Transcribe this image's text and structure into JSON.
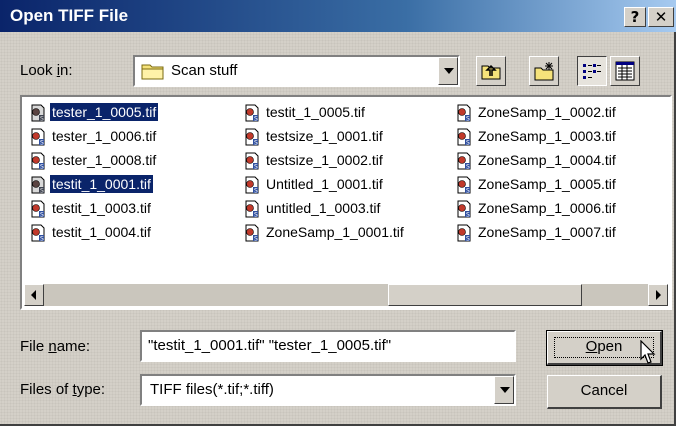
{
  "window": {
    "title": "Open TIFF File",
    "help_label": "?",
    "close_label": "✕"
  },
  "look_in": {
    "label_pre": "Look ",
    "label_accel": "i",
    "label_post": "n:",
    "value": "Scan stuff"
  },
  "files": {
    "columns": [
      [
        {
          "name": "tester_1_0005.tif",
          "selected": true
        },
        {
          "name": "tester_1_0006.tif",
          "selected": false
        },
        {
          "name": "tester_1_0008.tif",
          "selected": false
        },
        {
          "name": "testit_1_0001.tif",
          "selected": true
        },
        {
          "name": "testit_1_0003.tif",
          "selected": false
        },
        {
          "name": "testit_1_0004.tif",
          "selected": false
        }
      ],
      [
        {
          "name": "testit_1_0005.tif",
          "selected": false
        },
        {
          "name": "testsize_1_0001.tif",
          "selected": false
        },
        {
          "name": "testsize_1_0002.tif",
          "selected": false
        },
        {
          "name": "Untitled_1_0001.tif",
          "selected": false
        },
        {
          "name": "untitled_1_0003.tif",
          "selected": false
        },
        {
          "name": "ZoneSamp_1_0001.tif",
          "selected": false
        }
      ],
      [
        {
          "name": "ZoneSamp_1_0002.tif",
          "selected": false
        },
        {
          "name": "ZoneSamp_1_0003.tif",
          "selected": false
        },
        {
          "name": "ZoneSamp_1_0004.tif",
          "selected": false
        },
        {
          "name": "ZoneSamp_1_0005.tif",
          "selected": false
        },
        {
          "name": "ZoneSamp_1_0006.tif",
          "selected": false
        },
        {
          "name": "ZoneSamp_1_0007.tif",
          "selected": false
        }
      ]
    ]
  },
  "file_name": {
    "label_pre": "File ",
    "label_accel": "n",
    "label_post": "ame:",
    "value": "\"testit_1_0001.tif\" \"tester_1_0005.tif\""
  },
  "file_type": {
    "label_pre": "Files of ",
    "label_accel": "t",
    "label_post": "ype:",
    "value": "TIFF files(*.tif;*.tiff)"
  },
  "buttons": {
    "open_accel": "O",
    "open_rest": "pen",
    "cancel": "Cancel"
  },
  "colors": {
    "selection": "#0a246a",
    "dialog_face": "#d4d0c8",
    "title_gradient_start": "#0a246a"
  },
  "icons": {
    "up_folder": "up-folder-icon",
    "new_folder": "new-folder-icon",
    "list_view": "list-view-icon",
    "details_view": "details-view-icon",
    "folder": "folder-icon",
    "file": "tiff-file-icon"
  }
}
